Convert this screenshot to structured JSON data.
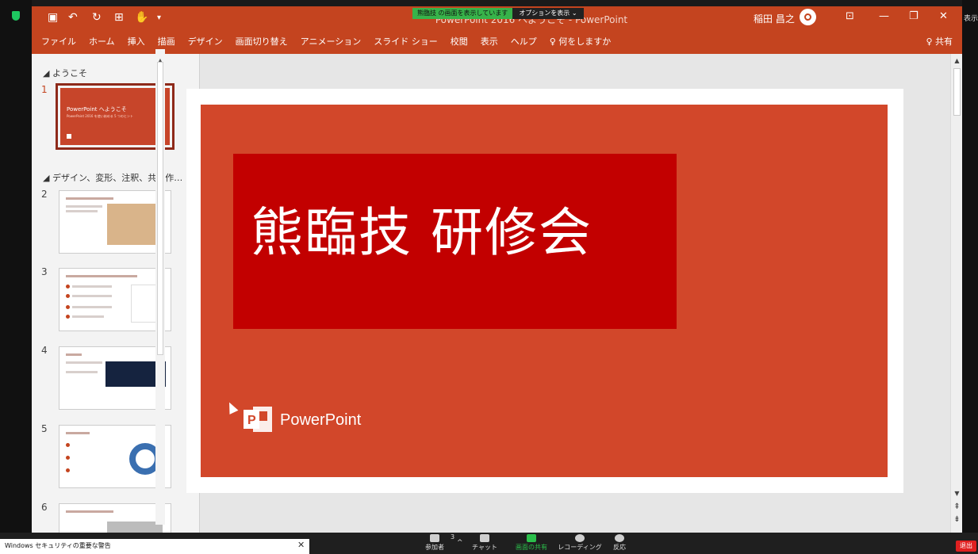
{
  "window": {
    "doc_title": "PowerPoint 2016 へようこそ - PowerPoint",
    "share_banner_green": "熊臨技 の画面を表示しています",
    "share_banner_dark": "オプションを表示 ⌄",
    "user_name": "稲田 昌之",
    "right_strip": "表示",
    "minimize": "—",
    "restore": "❐",
    "close": "✕"
  },
  "ribbon": {
    "tabs": [
      "ファイル",
      "ホーム",
      "挿入",
      "描画",
      "デザイン",
      "画面切り替え",
      "アニメーション",
      "スライド ショー",
      "校閲",
      "表示",
      "ヘルプ",
      "♀ 何をしますか"
    ],
    "share": "♀ 共有"
  },
  "thumbnails": {
    "section1": "◢ ようこそ",
    "section2": "◢ デザイン、変形、注釈、共同作…",
    "numbers": [
      "1",
      "2",
      "3",
      "4",
      "5",
      "6"
    ],
    "slide1_title": "PowerPoint へようこそ",
    "slide1_sub": "PowerPoint 2016 を使い始める 5 つのヒント"
  },
  "slide": {
    "title": "熊臨技  研修会",
    "logo_text": "PowerPoint"
  },
  "taskbar": {
    "notice": "Windows セキュリティの重要な警告",
    "notice_close": "✕",
    "participants_count": "3",
    "participants": "参加者",
    "chat": "チャット",
    "share": "画面の共有",
    "record": "レコーディング",
    "reactions": "反応",
    "leave": "退出"
  },
  "colors": {
    "ppt_accent": "#c4441f",
    "slide_bg": "#d2472a",
    "title_box": "#c20000",
    "zoom_share": "#2bbf4b"
  }
}
